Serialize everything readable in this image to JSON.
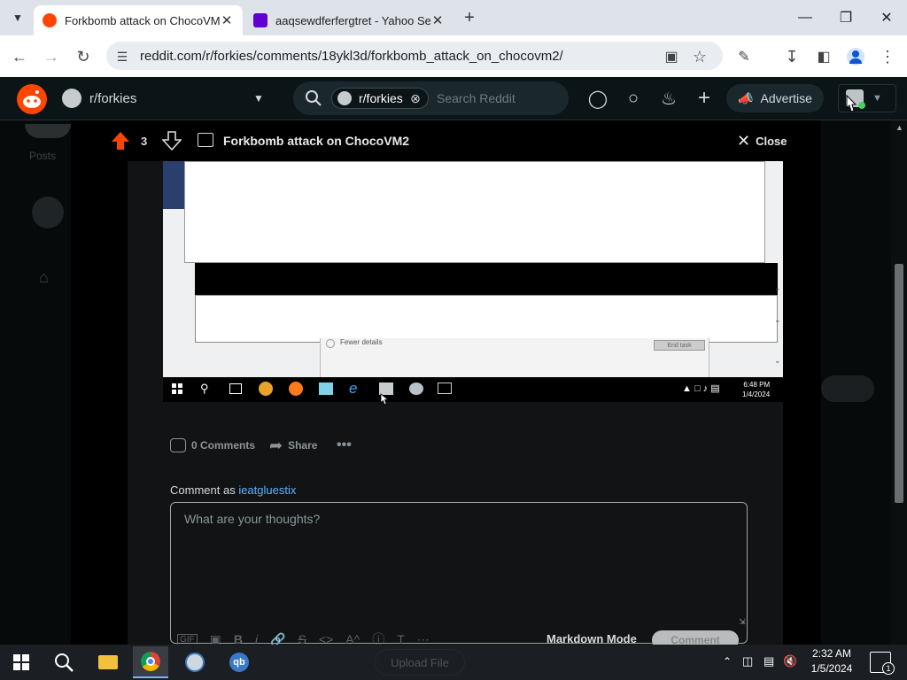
{
  "browser": {
    "tabs": [
      {
        "title": "Forkbomb attack on ChocoVM",
        "favicon": "reddit-icon",
        "active": true
      },
      {
        "title": "aaqsewdferfergtret - Yahoo Se",
        "favicon": "yahoo-icon",
        "active": false
      }
    ],
    "url": "reddit.com/r/forkies/comments/18ykl3d/forkbomb_attack_on_chocovm2/"
  },
  "reddit_header": {
    "community": "r/forkies",
    "search_chip": "r/forkies",
    "search_placeholder": "Search Reddit",
    "advertise_label": "Advertise"
  },
  "lightbox": {
    "vote_count": "3",
    "title": "Forkbomb attack on ChocoVM2",
    "close_label": "Close"
  },
  "screenshot_content": {
    "fewer_details": "Fewer details",
    "end_task": "End task",
    "vm_time": "6:48 PM",
    "vm_date": "1/4/2024"
  },
  "post_actions": {
    "comments": "0 Comments",
    "share": "Share"
  },
  "comment": {
    "comment_as_prefix": "Comment as ",
    "username": "ieatgluestix",
    "placeholder": "What are your thoughts?",
    "markdown_mode": "Markdown Mode",
    "submit": "Comment",
    "upload_file": "Upload File"
  },
  "taskbar": {
    "time": "2:32 AM",
    "date": "1/5/2024",
    "notification_count": "1"
  },
  "colors": {
    "reddit_orange": "#ff4500",
    "link_blue": "#5eb2ff",
    "bg_dark": "#0b1416"
  }
}
